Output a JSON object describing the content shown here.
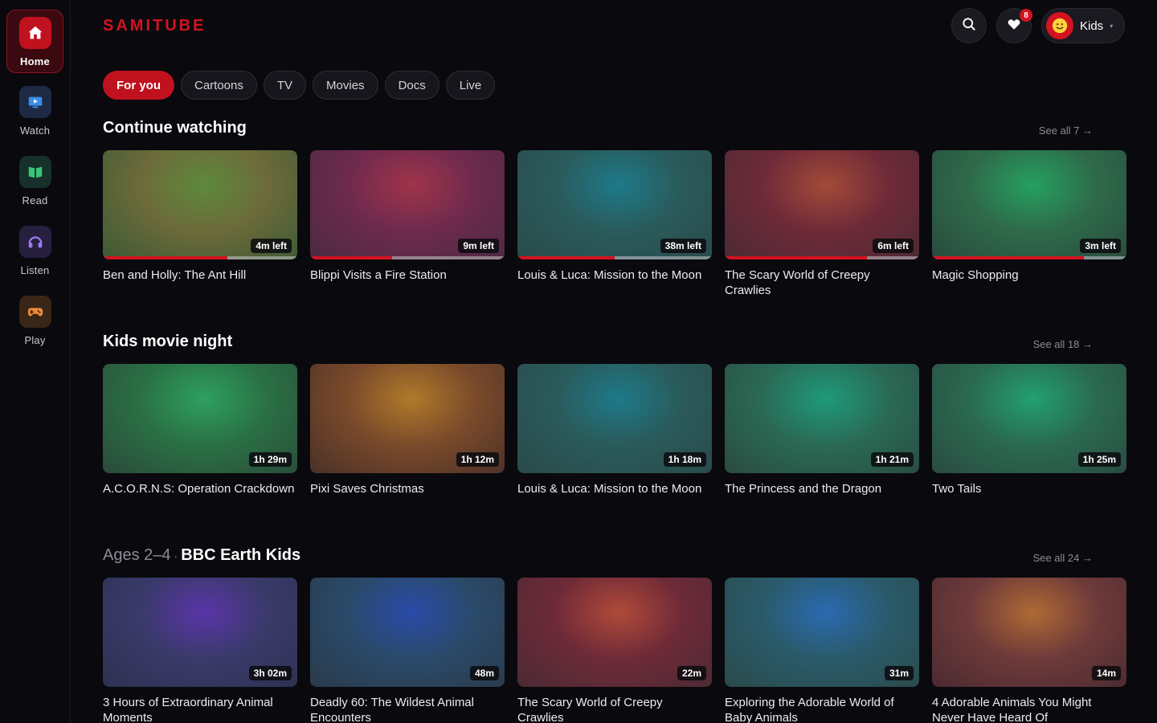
{
  "app": {
    "logo": "SAMITUBE"
  },
  "sidebar": {
    "items": [
      {
        "label": "Home",
        "icon": "home-icon",
        "color": "#c0111f",
        "active": true
      },
      {
        "label": "Watch",
        "icon": "tv-play-icon",
        "color": "#1d2a44"
      },
      {
        "label": "Read",
        "icon": "book-icon",
        "color": "#17302a"
      },
      {
        "label": "Listen",
        "icon": "headphones-icon",
        "color": "#261f3e"
      },
      {
        "label": "Play",
        "icon": "gamepad-icon",
        "color": "#3a2616"
      }
    ]
  },
  "header": {
    "search_icon": "search-icon",
    "favorites_icon": "heart-icon",
    "favorites_badge": "8",
    "profile_name": "Kids"
  },
  "tabs": [
    "For you",
    "Cartoons",
    "TV",
    "Movies",
    "Docs",
    "Live"
  ],
  "sections": [
    {
      "title": "Continue watching",
      "see_all": "See all 7 →",
      "cards": [
        {
          "title": "Ben and Holly: The Ant Hill",
          "duration": "4m left",
          "progress": 0.64,
          "colors": [
            "#5e8a3c",
            "#6c6a3a",
            "#3b5a34"
          ]
        },
        {
          "title": "Blippi Visits a Fire Station",
          "duration": "9m left",
          "progress": 0.42,
          "colors": [
            "#a0344a",
            "#6e2a4e",
            "#4a2a40"
          ]
        },
        {
          "title": "Louis & Luca: Mission to the Moon",
          "duration": "38m left",
          "progress": 0.5,
          "colors": [
            "#1d7a8a",
            "#2a5a5a",
            "#2a4a4a"
          ]
        },
        {
          "title": "The Scary World of Creepy Crawlies",
          "duration": "6m left",
          "progress": 0.73,
          "colors": [
            "#a34a38",
            "#6e2a38",
            "#4a2a34"
          ]
        },
        {
          "title": "Magic Shopping",
          "duration": "3m left",
          "progress": 0.78,
          "colors": [
            "#25a060",
            "#2e6a4a",
            "#2a4a3e"
          ]
        }
      ]
    },
    {
      "title": "Kids movie night",
      "see_all": "See all 18 →",
      "cards": [
        {
          "title": "A.C.O.R.N.S: Operation Crackdown",
          "duration": "1h 29m",
          "colors": [
            "#2ea060",
            "#2a7044",
            "#2a4a3a"
          ]
        },
        {
          "title": "Pixi Saves Christmas",
          "duration": "1h 12m",
          "colors": [
            "#b07a2a",
            "#7a4a2a",
            "#4a3028"
          ]
        },
        {
          "title": "Louis & Luca: Mission to the Moon",
          "duration": "1h 18m",
          "colors": [
            "#1d7a8a",
            "#2a5a5a",
            "#2a4a4a"
          ]
        },
        {
          "title": "The Princess and the Dragon",
          "duration": "1h 21m",
          "colors": [
            "#1e9a7a",
            "#2a6a55",
            "#2a4a40"
          ]
        },
        {
          "title": "Two Tails",
          "duration": "1h 25m",
          "colors": [
            "#22a070",
            "#2a6a50",
            "#2a4a40"
          ]
        }
      ]
    },
    {
      "title_muted": "Ages 2–4",
      "title_dot": "·",
      "title": "BBC Earth Kids",
      "see_all": "See all 24 →",
      "cards": [
        {
          "title": "3 Hours of Extraordinary Animal Moments",
          "duration": "3h 02m",
          "colors": [
            "#5a34a8",
            "#3a3a6a",
            "#2e3050"
          ]
        },
        {
          "title": "Deadly 60: The Wildest Animal Encounters",
          "duration": "48m",
          "colors": [
            "#2a4aa8",
            "#2a4a6a",
            "#2a3a4a"
          ]
        },
        {
          "title": "The Scary World of Creepy Crawlies",
          "duration": "22m",
          "colors": [
            "#b04a38",
            "#6e2a38",
            "#4a2a34"
          ]
        },
        {
          "title": "Exploring the Adorable World of Baby Animals",
          "duration": "31m",
          "colors": [
            "#2a6ab0",
            "#2a5a6a",
            "#2a4a4a"
          ]
        },
        {
          "title": "4 Adorable Animals You Might Never Have Heard Of",
          "duration": "14m",
          "colors": [
            "#b06a34",
            "#6e3a3a",
            "#4a2a30"
          ]
        }
      ]
    }
  ]
}
